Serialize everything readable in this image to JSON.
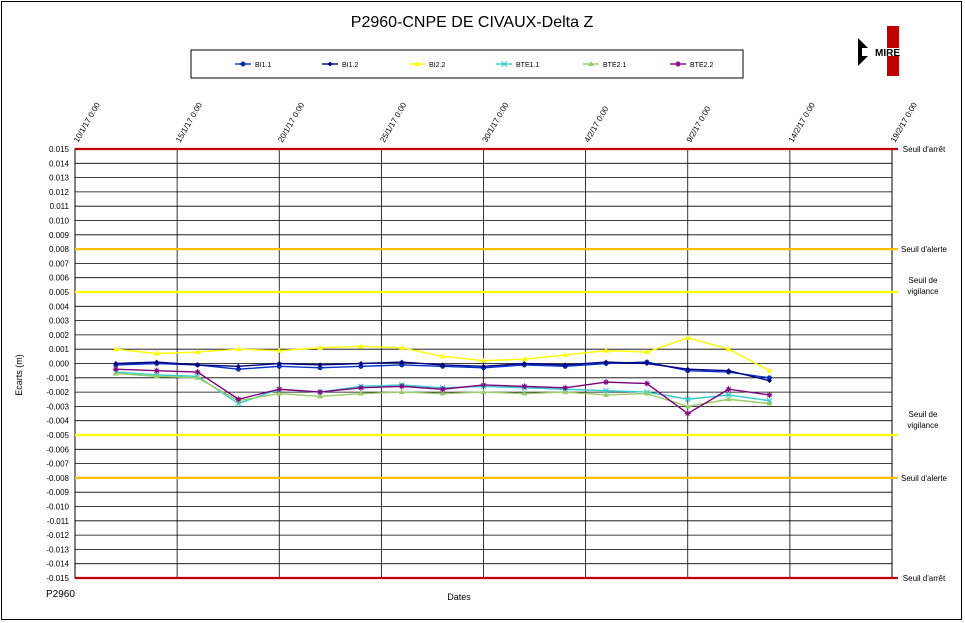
{
  "footer": {
    "left_label": "P2960"
  },
  "colors": {
    "background": "#ffffff",
    "arret": "#c00000",
    "alerte": "#ffc000",
    "vigilance": "#ffff00",
    "grid": "#000000"
  },
  "logo": {
    "text": "MIRE",
    "colors": [
      "#c00000",
      "#000000",
      "#ffffff"
    ]
  },
  "chart_data": {
    "type": "line",
    "title": "P2960-CNPE DE CIVAUX-Delta Z",
    "xlabel": "Dates",
    "ylabel": "Ecarts (m)",
    "xlim": [
      "2017-01-10",
      "2017-02-19"
    ],
    "x_ticks": [
      "10/1/17 0:00",
      "15/1/17 0:00",
      "20/1/17 0:00",
      "25/1/17 0:00",
      "30/1/17 0:00",
      "4/2/17 0:00",
      "9/2/17 0:00",
      "14/2/17 0:00",
      "19/2/17 0:00"
    ],
    "ylim": [
      -0.015,
      0.015
    ],
    "y_ticks": [
      "0.015",
      "0.014",
      "0.013",
      "0.012",
      "0.011",
      "0.010",
      "0.009",
      "0.008",
      "0.007",
      "0.006",
      "0.005",
      "0.004",
      "0.003",
      "0.002",
      "0.001",
      "0.000",
      "-0.001",
      "-0.002",
      "-0.003",
      "-0.004",
      "-0.005",
      "-0.006",
      "-0.007",
      "-0.008",
      "-0.009",
      "-0.010",
      "-0.011",
      "-0.012",
      "-0.013",
      "-0.014",
      "-0.015"
    ],
    "grid": true,
    "legend_position": "top",
    "thresholds": [
      {
        "label": "Seuil d'arrêt",
        "value": 0.015,
        "color": "#c00000"
      },
      {
        "label": "Seuil d'alerte",
        "value": 0.008,
        "color": "#ffc000"
      },
      {
        "label": "Seuil de vigilance",
        "value": 0.005,
        "color": "#ffff00"
      },
      {
        "label": "Seuil de vigilance",
        "value": -0.005,
        "color": "#ffff00"
      },
      {
        "label": "Seuil d'alerte",
        "value": -0.008,
        "color": "#ffc000"
      },
      {
        "label": "Seuil d'arrêt",
        "value": -0.015,
        "color": "#c00000"
      }
    ],
    "series": [
      {
        "name": "BI1.1",
        "color": "#0033cc",
        "marker": "circle",
        "x": [
          "2017-01-12",
          "2017-01-14",
          "2017-01-16",
          "2017-01-18",
          "2017-01-20",
          "2017-01-22",
          "2017-01-24",
          "2017-01-26",
          "2017-01-28",
          "2017-01-30",
          "2017-02-01",
          "2017-02-03",
          "2017-02-05",
          "2017-02-07",
          "2017-02-09",
          "2017-02-11",
          "2017-02-13"
        ],
        "y": [
          -0.0001,
          0.0,
          -0.0001,
          -0.0004,
          -0.0002,
          -0.0003,
          -0.0002,
          -0.0001,
          -0.0002,
          -0.0003,
          -0.0001,
          -0.0002,
          0.0,
          0.0001,
          -0.0005,
          -0.0006,
          -0.001
        ]
      },
      {
        "name": "BI1.2",
        "color": "#000080",
        "marker": "diamond",
        "x": [
          "2017-01-12",
          "2017-01-14",
          "2017-01-16",
          "2017-01-18",
          "2017-01-20",
          "2017-01-22",
          "2017-01-24",
          "2017-01-26",
          "2017-01-28",
          "2017-01-30",
          "2017-02-01",
          "2017-02-03",
          "2017-02-05",
          "2017-02-07",
          "2017-02-09",
          "2017-02-11",
          "2017-02-13"
        ],
        "y": [
          0.0,
          0.0001,
          -0.0001,
          -0.0002,
          0.0,
          -0.0001,
          0.0,
          0.0001,
          -0.0001,
          -0.0002,
          0.0,
          -0.0001,
          0.0001,
          0.0,
          -0.0004,
          -0.0005,
          -0.0012
        ]
      },
      {
        "name": "BI2.2",
        "color": "#ffff00",
        "marker": "triangle",
        "x": [
          "2017-01-12",
          "2017-01-14",
          "2017-01-16",
          "2017-01-18",
          "2017-01-20",
          "2017-01-22",
          "2017-01-24",
          "2017-01-26",
          "2017-01-28",
          "2017-01-30",
          "2017-02-01",
          "2017-02-03",
          "2017-02-05",
          "2017-02-07",
          "2017-02-09",
          "2017-02-11",
          "2017-02-13"
        ],
        "y": [
          0.001,
          0.0007,
          0.0008,
          0.001,
          0.0009,
          0.0011,
          0.0012,
          0.0011,
          0.0005,
          0.0002,
          0.0003,
          0.0006,
          0.0009,
          0.0008,
          0.0018,
          0.001,
          -0.0005
        ]
      },
      {
        "name": "BTE1.1",
        "color": "#33cccc",
        "marker": "cross",
        "x": [
          "2017-01-12",
          "2017-01-14",
          "2017-01-16",
          "2017-01-18",
          "2017-01-20",
          "2017-01-22",
          "2017-01-24",
          "2017-01-26",
          "2017-01-28",
          "2017-01-30",
          "2017-02-01",
          "2017-02-03",
          "2017-02-05",
          "2017-02-07",
          "2017-02-09",
          "2017-02-11",
          "2017-02-13"
        ],
        "y": [
          -0.0006,
          -0.0008,
          -0.0009,
          -0.0028,
          -0.0018,
          -0.002,
          -0.0016,
          -0.0015,
          -0.0017,
          -0.0016,
          -0.0017,
          -0.0018,
          -0.0019,
          -0.002,
          -0.0025,
          -0.0022,
          -0.0026
        ]
      },
      {
        "name": "BTE2.1",
        "color": "#99cc66",
        "marker": "triangle",
        "x": [
          "2017-01-12",
          "2017-01-14",
          "2017-01-16",
          "2017-01-18",
          "2017-01-20",
          "2017-01-22",
          "2017-01-24",
          "2017-01-26",
          "2017-01-28",
          "2017-01-30",
          "2017-02-01",
          "2017-02-03",
          "2017-02-05",
          "2017-02-07",
          "2017-02-09",
          "2017-02-11",
          "2017-02-13"
        ],
        "y": [
          -0.0007,
          -0.0009,
          -0.001,
          -0.0026,
          -0.0021,
          -0.0023,
          -0.0021,
          -0.002,
          -0.0021,
          -0.002,
          -0.0021,
          -0.002,
          -0.0022,
          -0.0021,
          -0.003,
          -0.0025,
          -0.0028
        ]
      },
      {
        "name": "BTE2.2",
        "color": "#800080",
        "marker": "star",
        "x": [
          "2017-01-12",
          "2017-01-14",
          "2017-01-16",
          "2017-01-18",
          "2017-01-20",
          "2017-01-22",
          "2017-01-24",
          "2017-01-26",
          "2017-01-28",
          "2017-01-30",
          "2017-02-01",
          "2017-02-03",
          "2017-02-05",
          "2017-02-07",
          "2017-02-09",
          "2017-02-11",
          "2017-02-13"
        ],
        "y": [
          -0.0004,
          -0.0005,
          -0.0006,
          -0.0025,
          -0.0018,
          -0.002,
          -0.0017,
          -0.0016,
          -0.0018,
          -0.0015,
          -0.0016,
          -0.0017,
          -0.0013,
          -0.0014,
          -0.0035,
          -0.0018,
          -0.0022
        ]
      }
    ]
  }
}
